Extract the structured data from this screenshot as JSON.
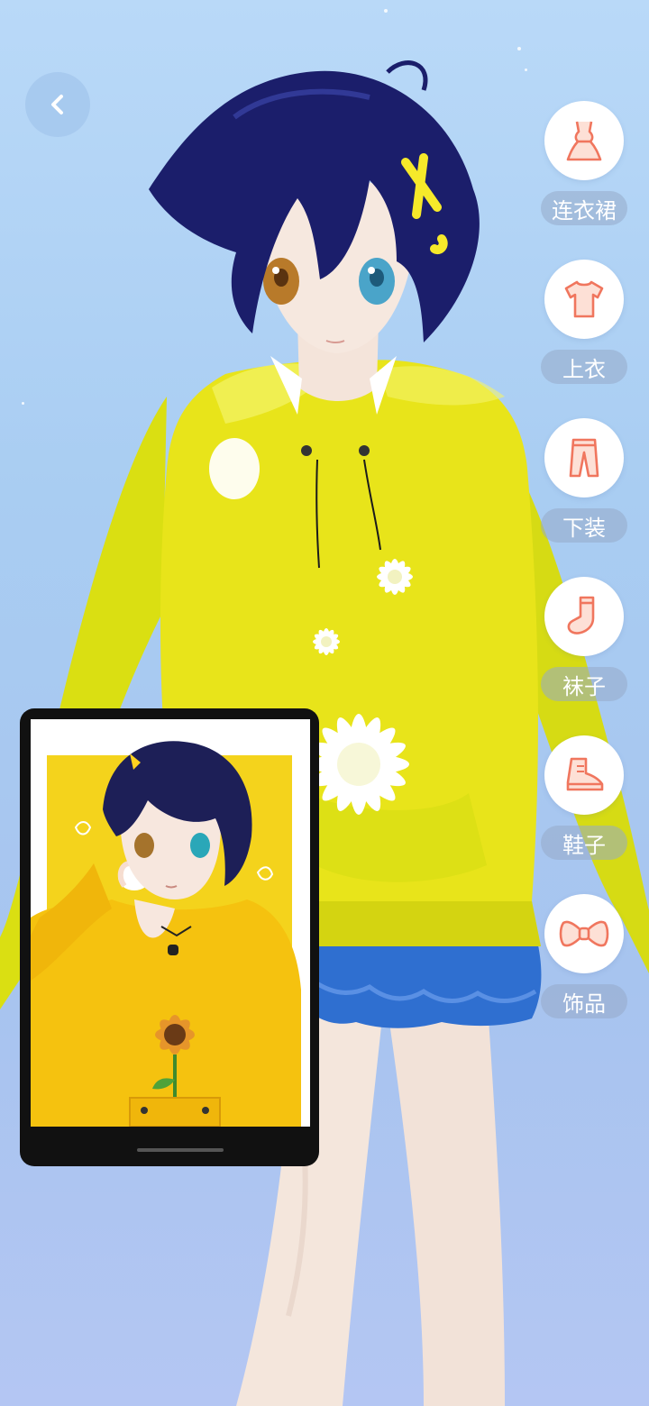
{
  "header": {
    "back_icon": "chevron-left-icon"
  },
  "categories": [
    {
      "key": "dress",
      "label": "连衣裙",
      "icon": "dress-icon"
    },
    {
      "key": "top",
      "label": "上衣",
      "icon": "tshirt-icon"
    },
    {
      "key": "bottom",
      "label": "下装",
      "icon": "pants-icon"
    },
    {
      "key": "socks",
      "label": "袜子",
      "icon": "sock-icon"
    },
    {
      "key": "shoes",
      "label": "鞋子",
      "icon": "shoe-icon"
    },
    {
      "key": "accessory",
      "label": "饰品",
      "icon": "bow-icon"
    }
  ],
  "colors": {
    "icon_stroke": "#f0765e",
    "icon_fill": "#fde0d6",
    "hoodie": "#e8e41a",
    "skirt": "#2f6fd0",
    "hair": "#1b1e6b"
  }
}
